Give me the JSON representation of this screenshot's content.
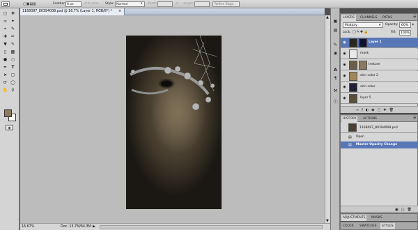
{
  "options_bar": {
    "feather_label": "Feather:",
    "feather_value": "0 px",
    "antialias_label": "Anti-alias",
    "style_label": "Style:",
    "style_value": "Normal",
    "width_label": "Width:",
    "height_label": "Height:",
    "refine_edge_label": "Refine Edge..."
  },
  "document": {
    "title": "1168097_80394008.psd @ 16.7% (Layer 1, RGB/8*) *",
    "zoom": "16.67%",
    "doc_info": "Doc: 15.7M/64.3M"
  },
  "layers_panel": {
    "tabs": [
      "LAYERS",
      "CHANNELS",
      "PATHS"
    ],
    "blend_mode": "Multiply",
    "opacity_label": "Opacity:",
    "opacity_value": "60%",
    "lock_label": "Lock:",
    "fill_label": "Fill:",
    "fill_value": "100%",
    "layers": [
      {
        "name": "Layer 1",
        "selected": true
      },
      {
        "name": "mask",
        "selected": false
      },
      {
        "name": "texture",
        "selected": false
      },
      {
        "name": "skin color 2",
        "selected": false
      },
      {
        "name": "skin color",
        "selected": false
      },
      {
        "name": "layer 5",
        "selected": false
      }
    ]
  },
  "history_panel": {
    "tabs": [
      "HISTORY",
      "ACTIONS"
    ],
    "snapshot": "1168097_80394008.psd",
    "items": [
      "Open",
      "Master Opacity Change"
    ]
  },
  "adjustments_panel": {
    "tabs": [
      "ADJUSTMENTS",
      "MASKS"
    ]
  },
  "styles_panel": {
    "tabs": [
      "COLOR",
      "SWATCHES",
      "STYLES"
    ]
  },
  "colors": {
    "foreground": "#8c7a5c",
    "background": "#ffffff",
    "selection": "#5877b7"
  }
}
